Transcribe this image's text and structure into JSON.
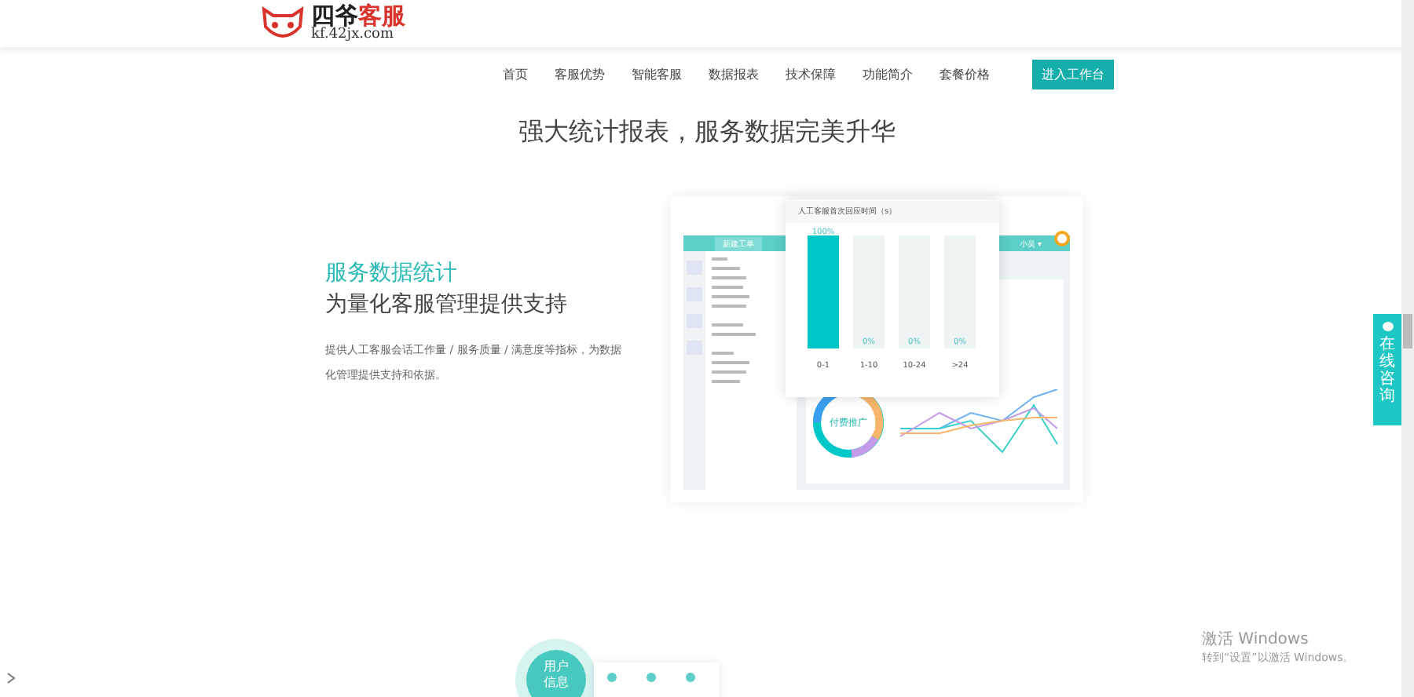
{
  "logo": {
    "name_main": "四爷",
    "name_accent": "客服",
    "domain": "kf.42jx.com"
  },
  "nav": {
    "items": [
      {
        "label": "首页",
        "selected": false
      },
      {
        "label": "客服优势",
        "selected": false
      },
      {
        "label": "智能客服",
        "selected": false
      },
      {
        "label": "数据报表",
        "selected": false
      },
      {
        "label": "技术保障",
        "selected": false
      },
      {
        "label": "功能简介",
        "selected": false
      },
      {
        "label": "套餐价格",
        "selected": false
      }
    ],
    "cta": "进入工作台"
  },
  "section_title": "强大统计报表，服务数据完美升华",
  "feature": {
    "title": "服务数据统计",
    "subtitle": "为量化客服管理提供支持",
    "description": "提供人工客服会话工作量 / 服务质量 / 满意度等指标，为数据化管理提供支持和依据。"
  },
  "mockup": {
    "header_button": "新建工单",
    "user": "小吴 ▾",
    "donut_label": "付费推广",
    "chart": {
      "chart_data": {
        "type": "bar",
        "title": "人工客服首次回应时间（s）",
        "categories": [
          "0-1",
          "1-10",
          "10-24",
          ">24"
        ],
        "values": [
          100,
          0,
          0,
          0
        ],
        "value_labels": [
          "100%",
          "0%",
          "0%",
          "0%"
        ]
      }
    }
  },
  "float_tab": "在线咨询",
  "bottom": {
    "bubble": "用户信息"
  },
  "os_notice": {
    "title": "激活 Windows",
    "text": "转到“设置”以激活 Windows。"
  }
}
